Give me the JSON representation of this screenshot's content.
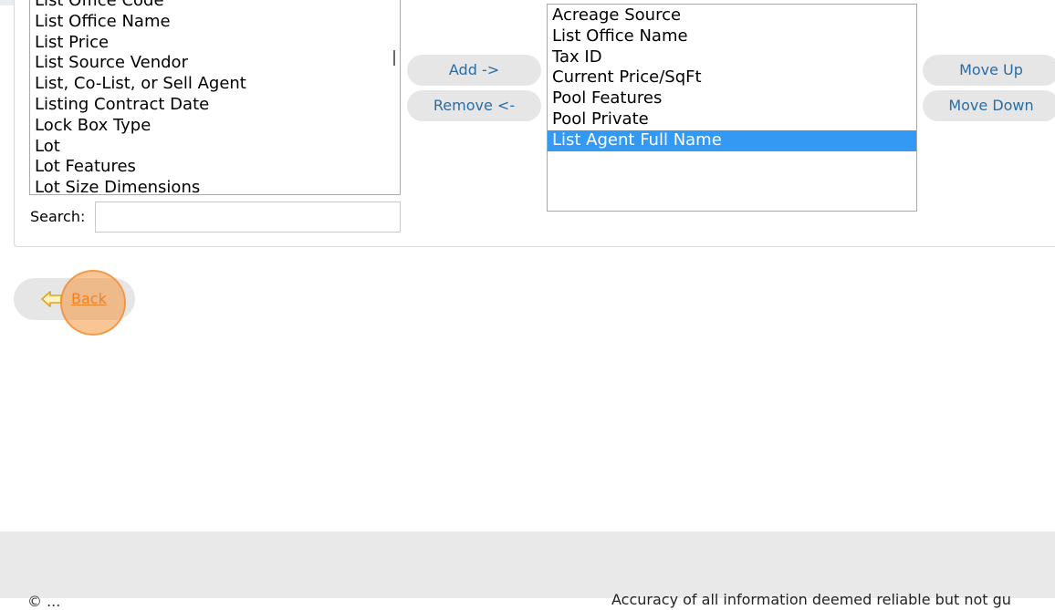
{
  "available_fields": {
    "options": [
      "List Office Code",
      "List Office Name",
      "List Price",
      "List Source Vendor",
      "List, Co-List, or Sell Agent",
      "Listing Contract Date",
      "Lock Box Type",
      "Lot",
      "Lot Features",
      "Lot Size Dimensions"
    ]
  },
  "selected_fields": {
    "options": [
      "Acreage Source",
      "List Office Name",
      "Tax ID",
      "Current Price/SqFt",
      "Pool Features",
      "Pool Private",
      "List Agent Full Name"
    ],
    "selected": "List Agent Full Name"
  },
  "buttons": {
    "add": "Add ->",
    "remove": "Remove <-",
    "move_up": "Move Up",
    "move_down": "Move Down"
  },
  "search": {
    "label": "Search:",
    "value": ""
  },
  "back": {
    "label": "Back",
    "arrow_icon": "left-arrow-icon"
  },
  "footer": {
    "left_text": "© ...",
    "disclaimer": "Accuracy of all information deemed reliable but not gu"
  },
  "colors": {
    "selection": "#3399f3",
    "button_bg": "#e6e6e6",
    "button_text": "#2b6ca3",
    "link": "#e36c09",
    "highlight": "#f5963c"
  }
}
